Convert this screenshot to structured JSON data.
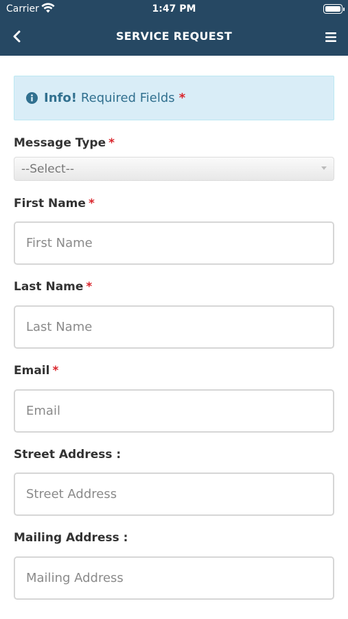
{
  "status_bar": {
    "carrier": "Carrier",
    "time": "1:47 PM"
  },
  "nav": {
    "title": "SERVICE REQUEST",
    "back_icon": "chevron-left-icon",
    "menu_icon": "hamburger-menu-icon"
  },
  "info": {
    "strong": "Info!",
    "text": "Required Fields",
    "star": "*",
    "icon": "info-circle-icon"
  },
  "colors": {
    "header_bg": "#264863",
    "info_bg": "#d9edf7",
    "info_text": "#31708f",
    "required": "#d9242b"
  },
  "form": {
    "message_type": {
      "label": "Message Type",
      "required": "*",
      "selected": "--Select--"
    },
    "first_name": {
      "label": "First Name",
      "required": "*",
      "placeholder": "First Name",
      "value": ""
    },
    "last_name": {
      "label": "Last Name",
      "required": "*",
      "placeholder": "Last Name",
      "value": ""
    },
    "email": {
      "label": "Email",
      "required": "*",
      "placeholder": "Email",
      "value": ""
    },
    "street_address": {
      "label": "Street Address :",
      "placeholder": "Street Address",
      "value": ""
    },
    "mailing_address": {
      "label": "Mailing Address :",
      "placeholder": "Mailing Address",
      "value": ""
    }
  }
}
